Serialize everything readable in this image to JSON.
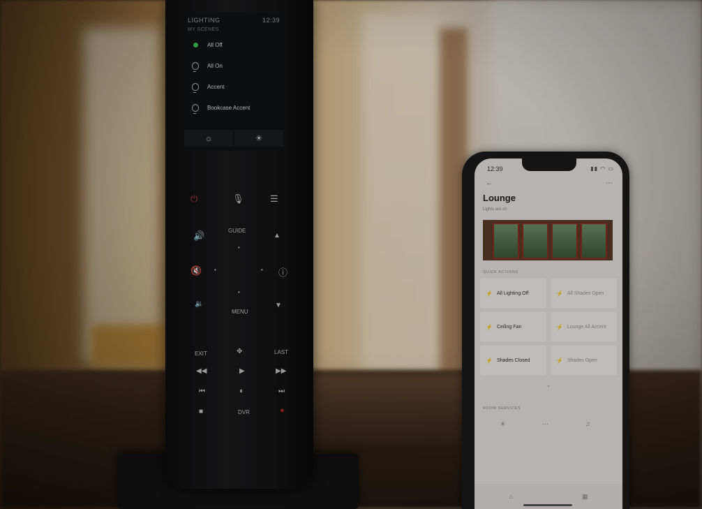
{
  "remote": {
    "screen": {
      "title": "LIGHTING",
      "time": "12:39",
      "subtitle": "MY SCENES",
      "scenes": [
        {
          "label": "All Off",
          "icon": "green-dot-icon"
        },
        {
          "label": "All On",
          "icon": "bulb-icon"
        },
        {
          "label": "Accent",
          "icon": "bulb-icon"
        },
        {
          "label": "Bookcase Accent",
          "icon": "bulb-icon"
        }
      ]
    },
    "buttons": {
      "guide": "GUIDE",
      "menu": "MENU",
      "exit": "EXIT",
      "last": "LAST",
      "dvr": "DVR"
    }
  },
  "phone": {
    "time": "12:39",
    "title": "Lounge",
    "subtitle": "Lights are on",
    "quick_actions_label": "QUICK ACTIONS",
    "quick_actions": [
      {
        "label": "All Lighting Off",
        "dim": false
      },
      {
        "label": "All Shades Open",
        "dim": true
      },
      {
        "label": "Ceiling Fan",
        "dim": false
      },
      {
        "label": "Lounge All Accent",
        "dim": true
      },
      {
        "label": "Shades Closed",
        "dim": false
      },
      {
        "label": "Shades Open",
        "dim": true
      }
    ],
    "room_services_label": "ROOM SERVICES"
  },
  "colors": {
    "accent_bolt": "#e0a020",
    "power_red": "#c03a3a",
    "active_green": "#39c45a"
  }
}
